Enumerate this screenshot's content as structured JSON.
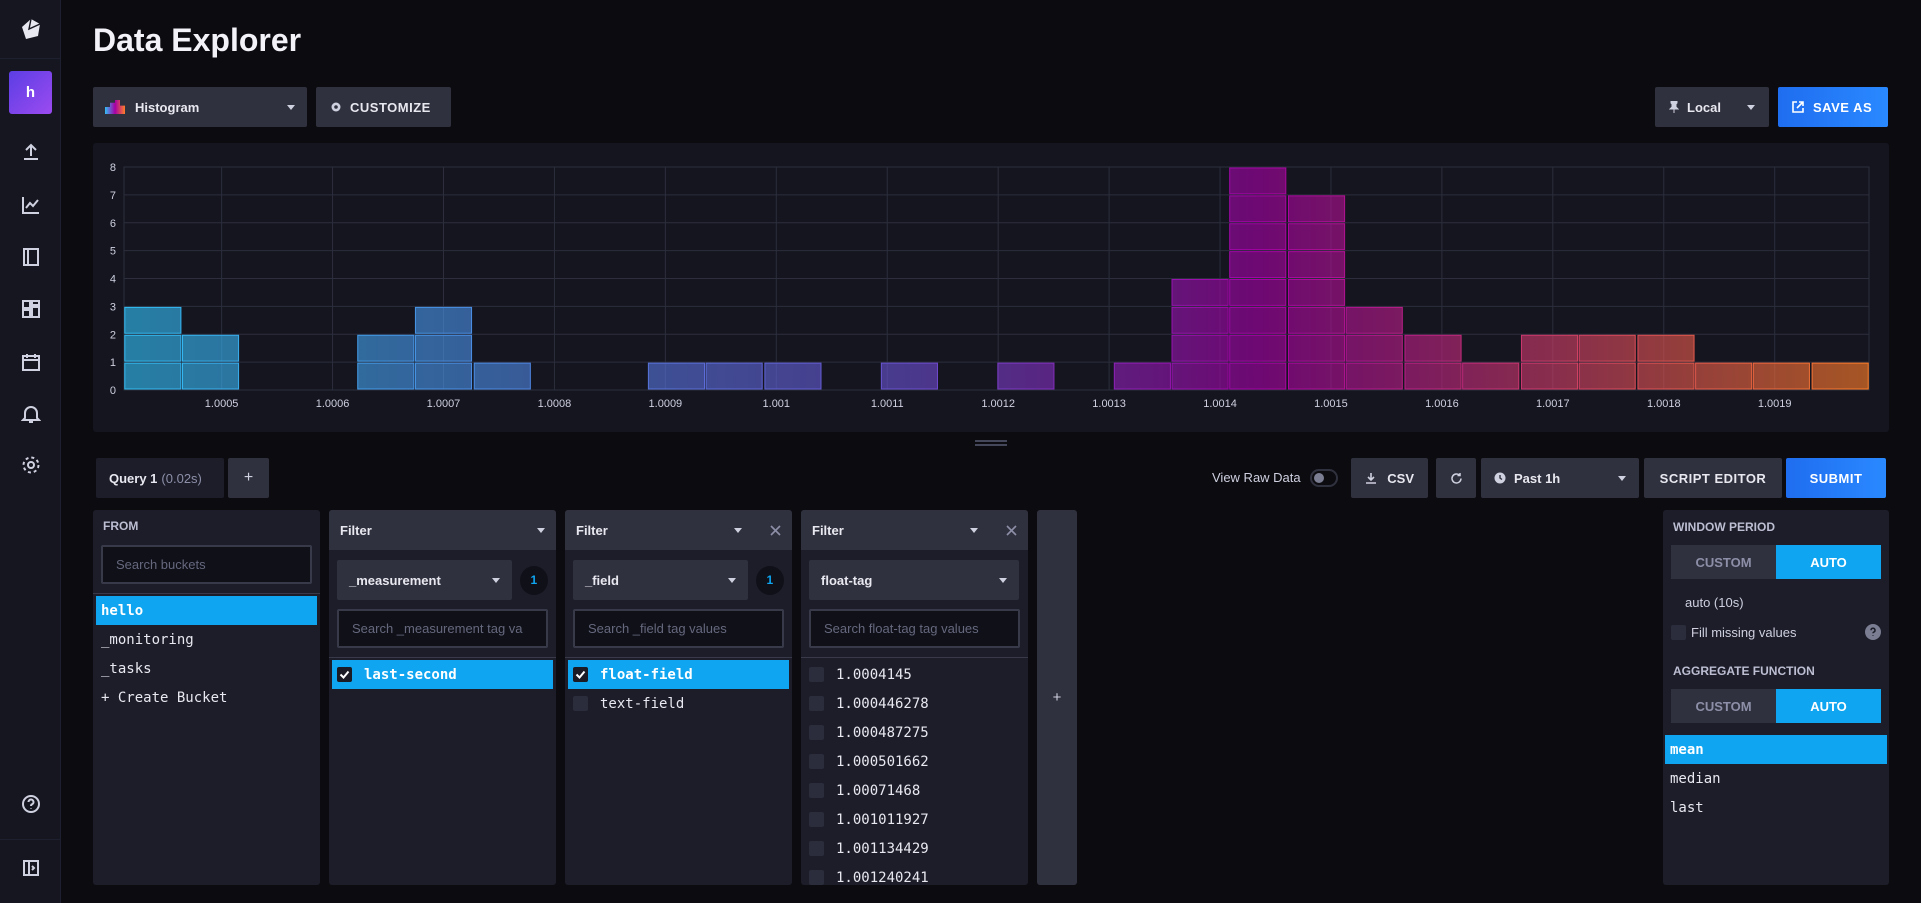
{
  "page": {
    "title": "Data Explorer"
  },
  "sidebar": {
    "avatar_letter": "h",
    "icons": [
      "upload-icon",
      "graph-icon",
      "notebook-icon",
      "dashboard-icon",
      "calendar-icon",
      "bell-icon",
      "gear-icon"
    ],
    "bottom_icons": [
      "help-icon",
      "collapse-sidebar-icon"
    ]
  },
  "toolbar": {
    "view_type": "Histogram",
    "customize_label": "CUSTOMIZE",
    "timezone": "Local",
    "save_as_label": "SAVE AS"
  },
  "chart_data": {
    "type": "bar",
    "subtype": "histogram",
    "x_ticks": [
      "1.0005",
      "1.0006",
      "1.0007",
      "1.0008",
      "1.0009",
      "1.001",
      "1.0011",
      "1.0012",
      "1.0013",
      "1.0014",
      "1.0015",
      "1.0016",
      "1.0017",
      "1.0018",
      "1.0019"
    ],
    "y_ticks": [
      "0",
      "1",
      "2",
      "3",
      "4",
      "5",
      "6",
      "7",
      "8"
    ],
    "ylim": [
      0,
      8
    ],
    "xlim": [
      1.000412,
      1.001985
    ],
    "bin_width": 5.24e-05,
    "bins": [
      {
        "x": 1.000438,
        "count": 3
      },
      {
        "x": 1.00049,
        "count": 2
      },
      {
        "x": 1.000543,
        "count": 0
      },
      {
        "x": 1.000595,
        "count": 0
      },
      {
        "x": 1.000648,
        "count": 2
      },
      {
        "x": 1.0007,
        "count": 3
      },
      {
        "x": 1.000753,
        "count": 1
      },
      {
        "x": 1.000805,
        "count": 0
      },
      {
        "x": 1.000858,
        "count": 0
      },
      {
        "x": 1.00091,
        "count": 1
      },
      {
        "x": 1.000962,
        "count": 1
      },
      {
        "x": 1.001015,
        "count": 1
      },
      {
        "x": 1.001067,
        "count": 0
      },
      {
        "x": 1.00112,
        "count": 1
      },
      {
        "x": 1.001172,
        "count": 0
      },
      {
        "x": 1.001225,
        "count": 1
      },
      {
        "x": 1.001277,
        "count": 0
      },
      {
        "x": 1.00133,
        "count": 1
      },
      {
        "x": 1.001382,
        "count": 4
      },
      {
        "x": 1.001434,
        "count": 8
      },
      {
        "x": 1.001487,
        "count": 7
      },
      {
        "x": 1.001539,
        "count": 3
      },
      {
        "x": 1.001592,
        "count": 2
      },
      {
        "x": 1.001644,
        "count": 1
      },
      {
        "x": 1.001697,
        "count": 2
      },
      {
        "x": 1.001749,
        "count": 2
      },
      {
        "x": 1.001802,
        "count": 2
      },
      {
        "x": 1.001854,
        "count": 1
      },
      {
        "x": 1.001906,
        "count": 1
      },
      {
        "x": 1.001959,
        "count": 1
      }
    ],
    "colors": [
      "#31c0f6",
      "#a500a5",
      "#ff7e27"
    ],
    "grid": true
  },
  "query_bar": {
    "tab_label": "Query 1",
    "tab_time": "(0.02s)",
    "add_label": "+",
    "view_raw_label": "View Raw Data",
    "csv_label": "CSV",
    "time_range": "Past 1h",
    "script_editor_label": "SCRIPT EDITOR",
    "submit_label": "SUBMIT"
  },
  "from_panel": {
    "label": "FROM",
    "search_placeholder": "Search buckets",
    "buckets": [
      "hello",
      "_monitoring",
      "_tasks",
      "+ Create Bucket"
    ]
  },
  "filters": [
    {
      "header": "Filter",
      "key": "_measurement",
      "count": "1",
      "search_placeholder": "Search _measurement tag va",
      "values": [
        {
          "label": "last-second",
          "selected": true
        }
      ]
    },
    {
      "header": "Filter",
      "key": "_field",
      "count": "1",
      "search_placeholder": "Search _field tag values",
      "values": [
        {
          "label": "float-field",
          "selected": true
        },
        {
          "label": "text-field",
          "selected": false
        }
      ]
    },
    {
      "header": "Filter",
      "key": "float-tag",
      "count": "",
      "search_placeholder": "Search float-tag tag values",
      "values": [
        {
          "label": "1.0004145",
          "selected": false
        },
        {
          "label": "1.000446278",
          "selected": false
        },
        {
          "label": "1.000487275",
          "selected": false
        },
        {
          "label": "1.000501662",
          "selected": false
        },
        {
          "label": "1.00071468",
          "selected": false
        },
        {
          "label": "1.001011927",
          "selected": false
        },
        {
          "label": "1.001134429",
          "selected": false
        },
        {
          "label": "1.001240241",
          "selected": false
        }
      ]
    }
  ],
  "add_filter_label": "+",
  "window_panel": {
    "window_label": "WINDOW PERIOD",
    "custom_label": "CUSTOM",
    "auto_label": "AUTO",
    "auto_value": "auto (10s)",
    "fill_missing_label": "Fill missing values",
    "aggregate_label": "AGGREGATE FUNCTION",
    "functions": [
      "mean",
      "median",
      "last"
    ]
  }
}
